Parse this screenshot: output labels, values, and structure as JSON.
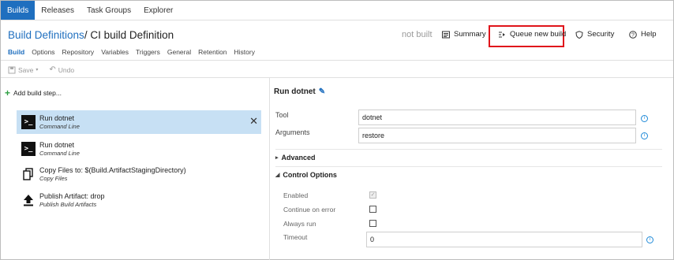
{
  "topnav": {
    "tabs": [
      {
        "label": "Builds"
      },
      {
        "label": "Releases"
      },
      {
        "label": "Task Groups"
      },
      {
        "label": "Explorer"
      }
    ]
  },
  "header": {
    "breadcrumb_link": "Build Definitions",
    "breadcrumb_sep": "/",
    "title": "CI build Definition",
    "status": "not built",
    "summary_label": "Summary",
    "queue_label": "Queue new build",
    "security_label": "Security",
    "help_label": "Help"
  },
  "subtabs": [
    "Build",
    "Options",
    "Repository",
    "Variables",
    "Triggers",
    "General",
    "Retention",
    "History"
  ],
  "toolbar": {
    "save_label": "Save",
    "undo_label": "Undo"
  },
  "steps_panel": {
    "add_label": "Add build step...",
    "steps": [
      {
        "title": "Run dotnet",
        "subtitle": "Command Line",
        "icon": "command-line-icon",
        "selected": true
      },
      {
        "title": "Run dotnet",
        "subtitle": "Command Line",
        "icon": "command-line-icon",
        "selected": false
      },
      {
        "title": "Copy Files to: $(Build.ArtifactStagingDirectory)",
        "subtitle": "Copy Files",
        "icon": "copy-files-icon",
        "selected": false
      },
      {
        "title": "Publish Artifact: drop",
        "subtitle": "Publish Build Artifacts",
        "icon": "publish-artifact-icon",
        "selected": false
      }
    ]
  },
  "details": {
    "title": "Run dotnet",
    "tool_label": "Tool",
    "tool_value": "dotnet",
    "arguments_label": "Arguments",
    "arguments_value": "restore",
    "advanced_label": "Advanced",
    "control_options_label": "Control Options",
    "enabled_label": "Enabled",
    "enabled_checked": true,
    "continue_label": "Continue on error",
    "continue_checked": false,
    "always_run_label": "Always run",
    "always_run_checked": false,
    "timeout_label": "Timeout",
    "timeout_value": "0"
  },
  "colors": {
    "accent": "#1f6fbf",
    "selected_row": "#c7e0f4",
    "highlight_box": "#e0141b"
  }
}
